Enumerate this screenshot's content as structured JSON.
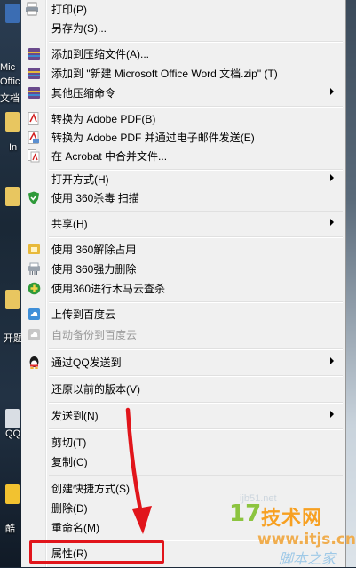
{
  "desktop_left": {
    "fragments": [
      "Mic",
      "Offic",
      "文档",
      "In",
      "开题",
      "QQ",
      "酷"
    ]
  },
  "menu": {
    "items": [
      {
        "label": "打印(P)",
        "icon": "print-icon"
      },
      {
        "label": "另存为(S)...",
        "icon": ""
      },
      {
        "label": "添加到压缩文件(A)...",
        "icon": "archive-icon"
      },
      {
        "label": "添加到 \"新建 Microsoft Office Word 文档.zip\" (T)",
        "icon": "archive-icon"
      },
      {
        "label": "其他压缩命令",
        "icon": "archive-icon",
        "submenu": true
      },
      {
        "label": "转换为 Adobe PDF(B)",
        "icon": "pdf-icon"
      },
      {
        "label": "转换为 Adobe PDF 并通过电子邮件发送(E)",
        "icon": "pdf-mail-icon"
      },
      {
        "label": "在 Acrobat 中合并文件...",
        "icon": "pdf-merge-icon"
      },
      {
        "label": "打开方式(H)",
        "icon": "",
        "submenu": true
      },
      {
        "label": "使用 360杀毒 扫描",
        "icon": "shield-icon"
      },
      {
        "label": "共享(H)",
        "icon": "",
        "submenu": true
      },
      {
        "label": "使用 360解除占用",
        "icon": "unlock-icon"
      },
      {
        "label": "使用 360强力删除",
        "icon": "shredder-icon"
      },
      {
        "label": "使用360进行木马云查杀",
        "icon": "plus-shield-icon"
      },
      {
        "label": "上传到百度云",
        "icon": "cloud-upload-icon"
      },
      {
        "label": "自动备份到百度云",
        "icon": "cloud-backup-icon",
        "disabled": true
      },
      {
        "label": "通过QQ发送到",
        "icon": "qq-icon",
        "submenu": true
      },
      {
        "label": "还原以前的版本(V)",
        "icon": ""
      },
      {
        "label": "发送到(N)",
        "icon": "",
        "submenu": true
      },
      {
        "label": "剪切(T)",
        "icon": ""
      },
      {
        "label": "复制(C)",
        "icon": ""
      },
      {
        "label": "创建快捷方式(S)",
        "icon": ""
      },
      {
        "label": "删除(D)",
        "icon": ""
      },
      {
        "label": "重命名(M)",
        "icon": ""
      },
      {
        "label": "属性(R)",
        "icon": ""
      }
    ]
  },
  "watermark": {
    "logo": "17",
    "title": "技术网",
    "url": "www.itjs.cn",
    "subtitle": "脚本之家",
    "faint": "ijb51.net"
  },
  "colors": {
    "menu_bg": "#f0f0f0",
    "highlight": "#e1151b",
    "arrow": "#e1151b"
  }
}
